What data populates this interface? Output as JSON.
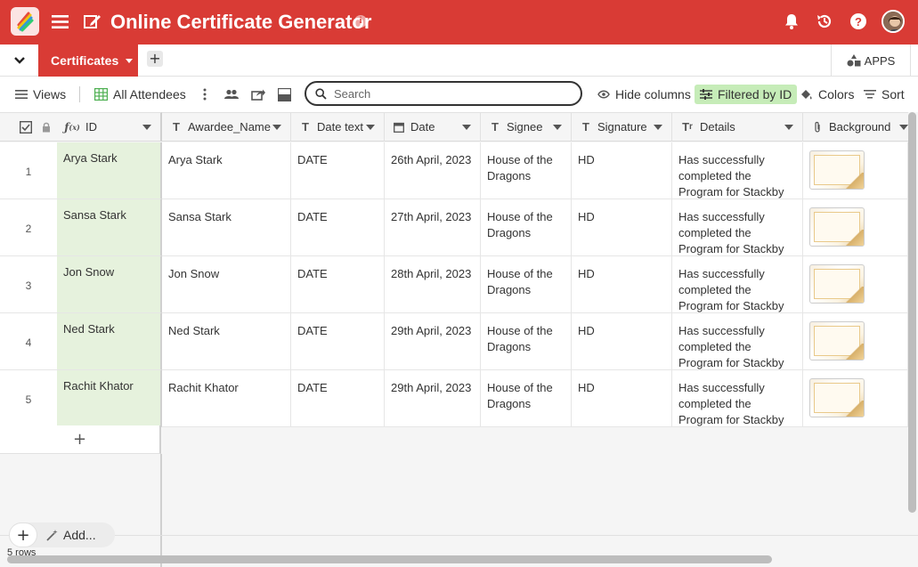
{
  "header": {
    "title": "Online Certificate Generator",
    "info": "i",
    "colors": {
      "bar": "#d93b35",
      "filter_pill": "#c6ecb8",
      "id_column": "#e6f2dd"
    }
  },
  "tabs": {
    "active": "Certificates",
    "apps": "APPS"
  },
  "toolbar": {
    "views": "Views",
    "view_name": "All Attendees",
    "search_placeholder": "Search",
    "hide_columns": "Hide columns",
    "filtered": "Filtered by ID",
    "colors": "Colors",
    "sort": "Sort"
  },
  "columns": [
    {
      "label": "ID",
      "type_icon": "formula-icon"
    },
    {
      "label": "Awardee_Name",
      "type_icon": "text-icon"
    },
    {
      "label": "Date text",
      "type_icon": "text-icon"
    },
    {
      "label": "Date",
      "type_icon": "calendar-icon"
    },
    {
      "label": "Signee",
      "type_icon": "text-icon"
    },
    {
      "label": "Signature",
      "type_icon": "text-icon"
    },
    {
      "label": "Details",
      "type_icon": "long-text-icon"
    },
    {
      "label": "Background",
      "type_icon": "attachment-icon"
    }
  ],
  "rows": [
    {
      "num": "1",
      "id": "Arya Stark",
      "name": "Arya Stark",
      "date_text": "DATE",
      "date": "26th April, 2023",
      "signee": "House of the Dragons",
      "signature": "HD",
      "details": "Has successfully completed the Program for Stackby"
    },
    {
      "num": "2",
      "id": "Sansa Stark",
      "name": "Sansa Stark",
      "date_text": "DATE",
      "date": "27th April, 2023",
      "signee": "House of the Dragons",
      "signature": "HD",
      "details": "Has successfully completed the Program for Stackby"
    },
    {
      "num": "3",
      "id": "Jon Snow",
      "name": "Jon Snow",
      "date_text": "DATE",
      "date": "28th April, 2023",
      "signee": "House of the Dragons",
      "signature": "HD",
      "details": "Has successfully completed the Program for Stackby"
    },
    {
      "num": "4",
      "id": "Ned Stark",
      "name": "Ned Stark",
      "date_text": "DATE",
      "date": "29th April, 2023",
      "signee": "House of the Dragons",
      "signature": "HD",
      "details": "Has successfully completed the Program for Stackby"
    },
    {
      "num": "5",
      "id": "Rachit Khator",
      "name": "Rachit Khator",
      "date_text": "DATE",
      "date": "29th April, 2023",
      "signee": "House of the Dragons",
      "signature": "HD",
      "details": "Has successfully completed the Program for Stackby"
    }
  ],
  "footer": {
    "add_label": "Add...",
    "row_count": "5 rows"
  }
}
